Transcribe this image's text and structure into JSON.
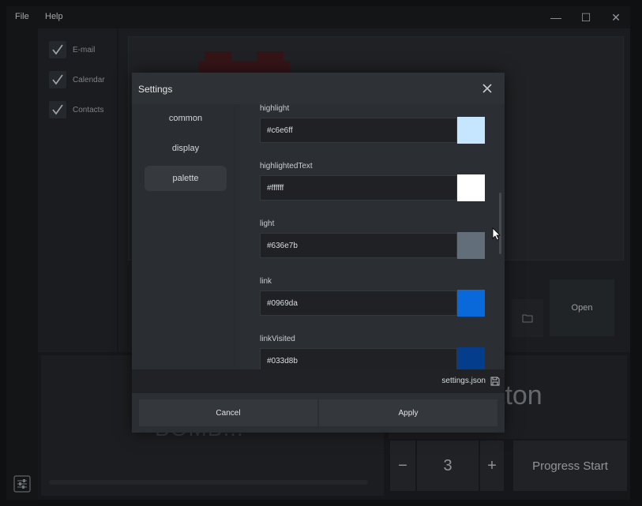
{
  "menu": {
    "file": "File",
    "help": "Help"
  },
  "window_controls": {
    "minimize": "—",
    "maximize": "☐",
    "close": "✕"
  },
  "checkboxes": [
    {
      "label": "E-mail",
      "checked": true
    },
    {
      "label": "Calendar",
      "checked": true
    },
    {
      "label": "Contacts",
      "checked": true
    }
  ],
  "background": {
    "open_button": "Open",
    "bomb_text": "BOMB...",
    "button_text": "tton",
    "stepper_value": "3",
    "stepper_minus": "−",
    "stepper_plus": "+",
    "progress_button": "Progress Start"
  },
  "dialog": {
    "title": "Settings",
    "sidebar": [
      {
        "label": "common",
        "active": false
      },
      {
        "label": "display",
        "active": false
      },
      {
        "label": "palette",
        "active": true
      }
    ],
    "colors": [
      {
        "name": "highlight",
        "value": "#c6e6ff",
        "swatch": "#c6e6ff"
      },
      {
        "name": "highlightedText",
        "value": "#ffffff",
        "swatch": "#ffffff"
      },
      {
        "name": "light",
        "value": "#636e7b",
        "swatch": "#636e7b"
      },
      {
        "name": "link",
        "value": "#0969da",
        "swatch": "#0969da"
      },
      {
        "name": "linkVisited",
        "value": "#033d8b",
        "swatch": "#033d8b"
      }
    ],
    "file_name": "settings.json",
    "cancel": "Cancel",
    "apply": "Apply"
  }
}
